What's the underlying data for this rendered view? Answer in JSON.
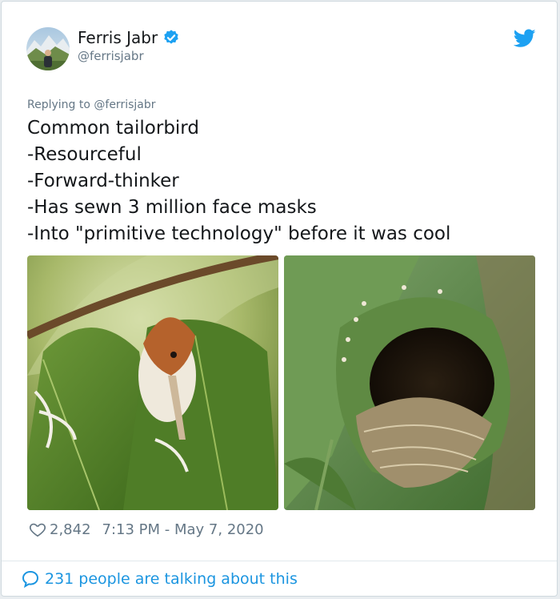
{
  "author": {
    "name": "Ferris Jabr",
    "handle": "@ferrisjabr"
  },
  "tweet": {
    "reply_prefix": "Replying to ",
    "reply_to": "@ferrisjabr",
    "lines": [
      "Common tailorbird",
      "-Resourceful",
      "-Forward-thinker",
      "-Has sewn 3 million face masks",
      "-Into \"primitive technology\" before it was cool"
    ],
    "likes": "2,842",
    "timestamp": "7:13 PM - May 7, 2020"
  },
  "footer": {
    "talking": "231 people are talking about this"
  },
  "colors": {
    "brand_blue": "#1da1f2",
    "link_blue": "#1b95e0",
    "text": "#14171a",
    "muted": "#657786"
  },
  "icons": [
    "verified-badge-icon",
    "twitter-bird-icon",
    "heart-icon",
    "chat-bubble-icon"
  ]
}
